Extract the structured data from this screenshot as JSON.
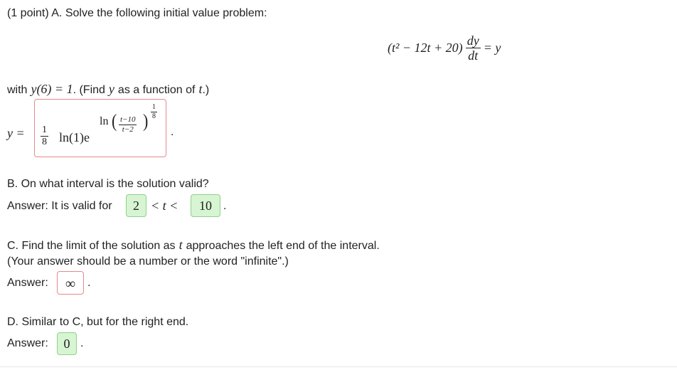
{
  "part_a": {
    "header": "(1 point) A. Solve the following initial value problem:",
    "equation": {
      "lhs_poly": "(t² − 12t + 20)",
      "deriv_num": "dy",
      "deriv_den": "dt",
      "rhs": "= y"
    },
    "condition_prefix": "with",
    "condition": "y(6) = 1",
    "condition_suffix": ". (Find",
    "condition_var": "y",
    "condition_middle": "as a function of",
    "condition_t": "t",
    "condition_end": ".)",
    "answer_label": "y =",
    "answer": {
      "coef_num": "1",
      "coef_den": "8",
      "ln_text": "ln(1)e",
      "exp_ln": "ln",
      "exp_inner_num": "t−10",
      "exp_inner_den": "t−2",
      "exp_power_num": "1",
      "exp_power_den": "8"
    },
    "answer_end": "."
  },
  "part_b": {
    "question": "B. On what interval is the solution valid?",
    "answer_prefix": "Answer: It is valid for",
    "lower": "2",
    "inequality": "< t <",
    "upper": "10",
    "end": "."
  },
  "part_c": {
    "question_line1": "C. Find the limit of the solution as",
    "question_var": "t",
    "question_line1_end": "approaches the left end of the interval.",
    "question_line2": "(Your answer should be a number or the word \"infinite\".)",
    "answer_label": "Answer:",
    "answer": "∞",
    "end": "."
  },
  "part_d": {
    "question": "D. Similar to C, but for the right end.",
    "answer_label": "Answer:",
    "answer": "0",
    "end": "."
  },
  "colors": {
    "correct_bg": "#d7f5d2",
    "correct_border": "#8fd18a",
    "incorrect_border": "#e68a8a"
  }
}
